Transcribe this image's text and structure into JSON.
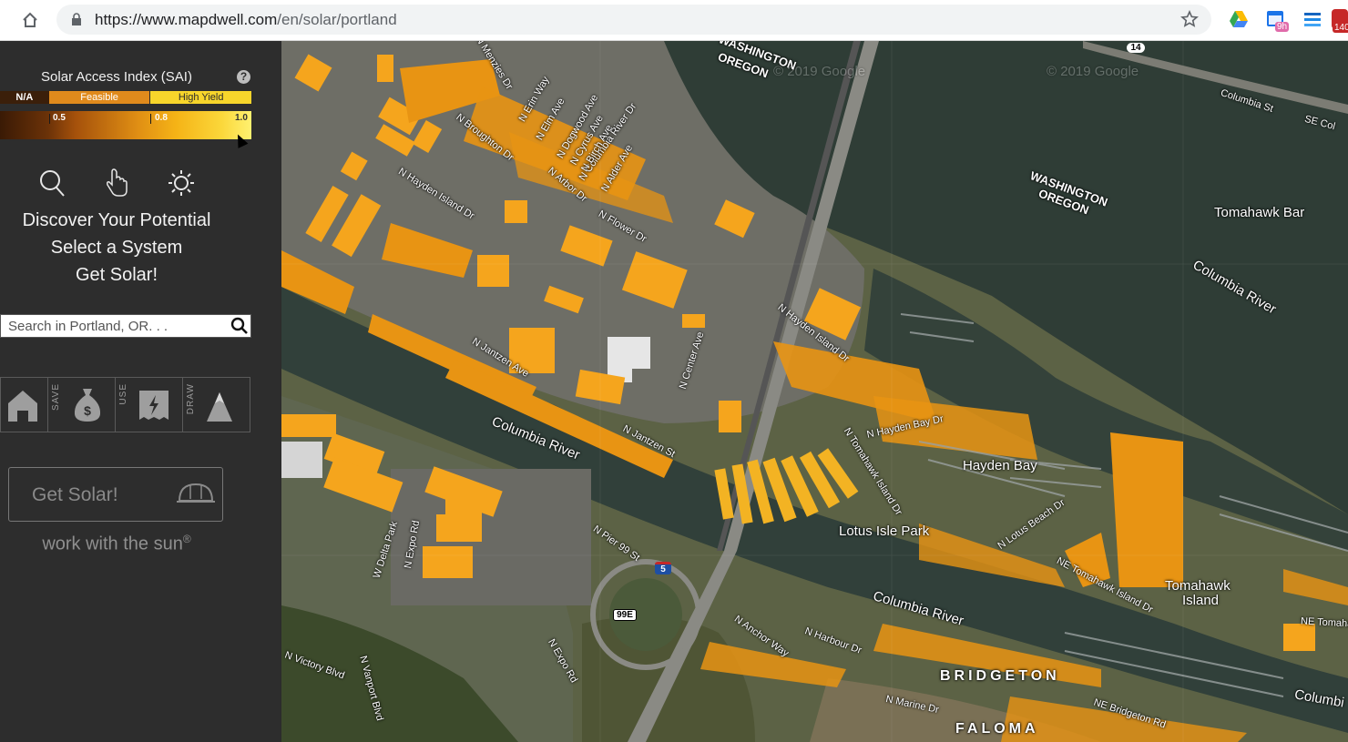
{
  "browser": {
    "back_glyph": "›",
    "url_host": "https://www.mapdwell.com",
    "url_path": "/en/solar/portland",
    "ext_badge_1": "9h",
    "ext_badge_2": "140"
  },
  "sai": {
    "title": "Solar Access Index (SAI)",
    "help": "?",
    "cat_na": "N/A",
    "cat_feasible": "Feasible",
    "cat_high": "High Yield",
    "tick_05": "0.5",
    "tick_08": "0.8",
    "tick_10": "1.0"
  },
  "taglines": {
    "line1": "Discover Your Potential",
    "line2": "Select a System",
    "line3": "Get Solar!"
  },
  "search": {
    "placeholder": "Search in Portland, OR. . ."
  },
  "modes": {
    "save": "SAVE",
    "use": "USE",
    "draw": "DRAW"
  },
  "cta": {
    "label": "Get Solar!",
    "tagline": "work with the sun",
    "reg": "®"
  },
  "map": {
    "labels": {
      "washington_oregon_1a": "WASHINGTON",
      "washington_oregon_1b": "OREGON",
      "washington_oregon_2a": "WASHINGTON",
      "washington_oregon_2b": "OREGON",
      "tomahawk_bar": "Tomahawk Bar",
      "columbia_river_ne": "Columbia River",
      "columbia_river_w": "Columbia River",
      "columbia_river_s": "Columbia River",
      "columbia_river_se": "Columbi",
      "columbia_st": "Columbia St",
      "se_col": "SE Col",
      "hwy_14": "14",
      "hwy_5": "5",
      "hwy_99e": "99E",
      "hayden_bay": "Hayden Bay",
      "lotus_isle_park": "Lotus Isle Park",
      "tomahawk_island_1": "Tomahawk",
      "tomahawk_island_2": "Island",
      "bridgeton": "BRIDGETON",
      "faloma": "FALOMA",
      "n_hayden_island_dr_w": "N Hayden Island Dr",
      "n_hayden_island_dr_e": "N Hayden Island Dr",
      "n_hayden_bay_dr": "N Hayden Bay Dr",
      "n_tomahawk_island_dr": "N Tomahawk Island Dr",
      "ne_tomahawk_island_dr": "NE Tomahawk Island Dr",
      "n_lotus_beach_dr": "N Lotus Beach Dr",
      "n_jantzen_ave": "N Jantzen Ave",
      "n_jantzen_st": "N Jantzen St",
      "n_center_ave": "N Center Ave",
      "n_pier_99_st": "N Pier 99 St",
      "n_menzies_dr": "N Menzies Dr",
      "n_erin_way": "N Erin Way",
      "n_elm_ave": "N Elm Ave",
      "n_dogwood_ave": "N Dogwood Ave",
      "n_cyrus_ave": "N Cyrus Ave",
      "n_columbia_river_dr": "N Columbia River Dr",
      "n_birch_ave": "N Birch Ave",
      "n_alder_ave": "N Alder Ave",
      "n_arbor_dr": "N Arbor Dr",
      "n_broughton_dr": "N Broughton Dr",
      "n_flower_dr": "N Flower Dr",
      "w_delta_park": "W Delta Park",
      "n_expo_rd": "N Expo Rd",
      "n_expo_rd_s": "N Expo Rd",
      "n_victory_blvd": "N Victory Blvd",
      "n_vanport_blvd": "N Vanport Blvd",
      "n_anchor_way": "N Anchor Way",
      "n_harbour_dr": "N Harbour Dr",
      "n_marine_dr": "N Marine Dr",
      "ne_bridgeton_rd": "NE Bridgeton Rd",
      "ne_tomaha": "NE Tomaha",
      "watermark_1": "© 2019 Google",
      "watermark_2": "© 2019 Google"
    }
  }
}
